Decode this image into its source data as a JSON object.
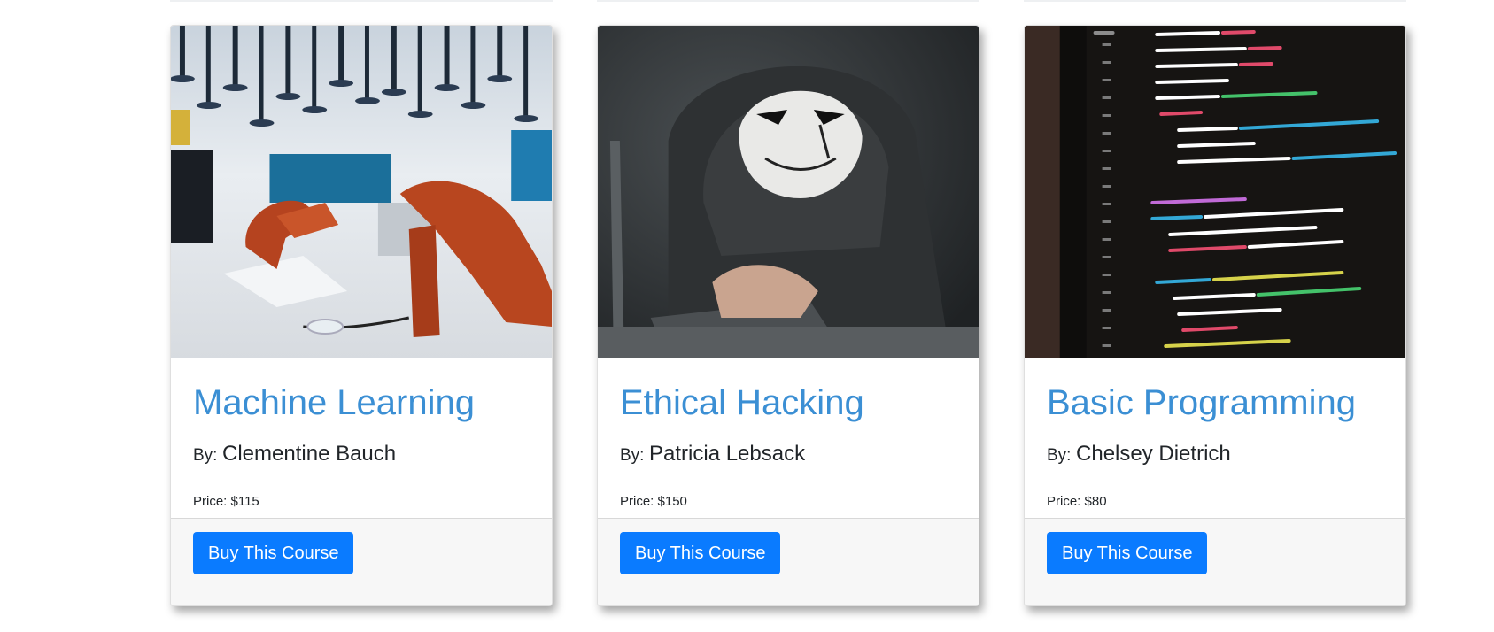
{
  "courses": [
    {
      "title": "Machine Learning",
      "by_label": "By:",
      "author": "Clementine Bauch",
      "price": "Price: $115",
      "button": "Buy This Course",
      "image": "robot-arms-lab-photo"
    },
    {
      "title": "Ethical Hacking",
      "by_label": "By:",
      "author": "Patricia Lebsack",
      "price": "Price: $150",
      "button": "Buy This Course",
      "image": "masked-hacker-laptop-photo"
    },
    {
      "title": "Basic Programming",
      "by_label": "By:",
      "author": "Chelsey Dietrich",
      "price": "Price: $80",
      "button": "Buy This Course",
      "image": "code-on-screen-photo"
    }
  ],
  "colors": {
    "title": "#3b8fd4",
    "button": "#0a7bff",
    "footer": "#f7f7f7"
  }
}
